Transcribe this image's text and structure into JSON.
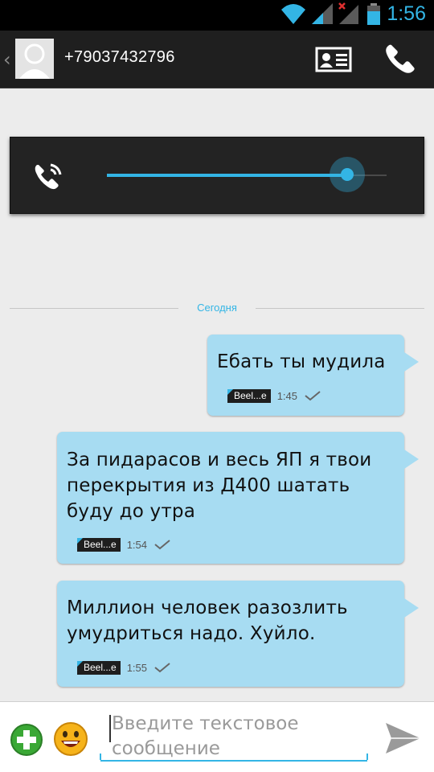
{
  "status_bar": {
    "time": "1:56",
    "icons": [
      "wifi-icon",
      "signal-icon",
      "no-signal-icon",
      "battery-icon"
    ]
  },
  "action_bar": {
    "back_glyph": "‹",
    "title": "+79037432796",
    "icons": [
      "avatar-placeholder-icon",
      "contact-card-icon",
      "call-icon"
    ]
  },
  "volume_panel": {
    "icon": "in-call-volume-icon",
    "level": 0.86,
    "accent": "#33b5e5"
  },
  "date_divider": "Сегодня",
  "messages": [
    {
      "text": "Ебать ты мудила",
      "carrier": "Beel...e",
      "time": "1:45"
    },
    {
      "text": "За пидарасов и весь ЯП я твои\nперекрытия из Д400 шатать\nбуду до утра",
      "carrier": "Beel...e",
      "time": "1:54"
    },
    {
      "text": "Миллион человек разозлить\nумудриться надо. Хуйло.",
      "carrier": "Beel...e",
      "time": "1:55"
    }
  ],
  "compose": {
    "placeholder": "Введите текстовое сообщение",
    "icons": [
      "add-attachment-icon",
      "emoji-icon",
      "send-icon"
    ]
  },
  "colors": {
    "accent": "#33b5e5",
    "bubble": "#a7dcf2",
    "status_bar": "#000000",
    "action_bar": "#1f1f1f",
    "background": "#ececec"
  }
}
